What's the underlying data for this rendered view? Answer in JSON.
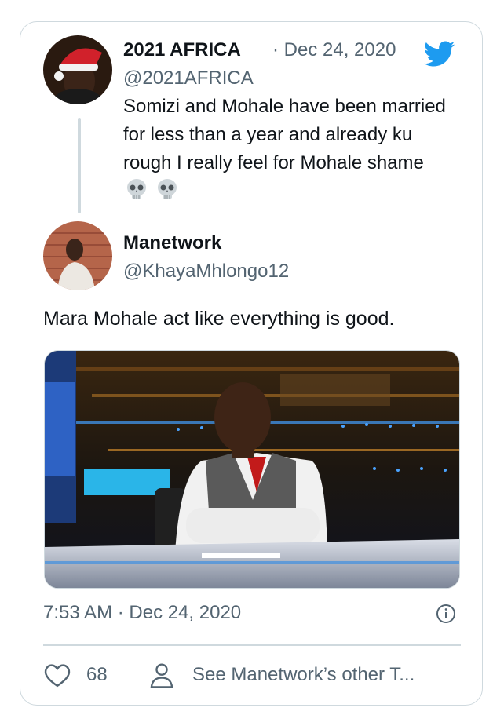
{
  "quoted_tweet": {
    "author_name": "2021 AFRICA",
    "handle": "@2021AFRICA",
    "date": "· Dec 24, 2020",
    "text": "Somizi and Mohale have been married for less than a year and already ku rough I really feel for Mohale shame",
    "emoji": [
      "skull",
      "skull"
    ]
  },
  "reply": {
    "author_name": "Manetwork",
    "handle": "@KhayaMhlongo12",
    "text": "Mara Mohale act like everything is good."
  },
  "meta": {
    "timestamp": "7:53 AM · Dec 24, 2020"
  },
  "actions": {
    "like_count": "68",
    "see_other_label": "See Manetwork’s other T..."
  },
  "colors": {
    "twitter_blue": "#1d9bf0",
    "secondary_text": "#536471",
    "border": "#cfd9de"
  },
  "icons": [
    "twitter-bird-icon",
    "info-icon",
    "heart-icon",
    "person-icon",
    "skull-icon"
  ]
}
